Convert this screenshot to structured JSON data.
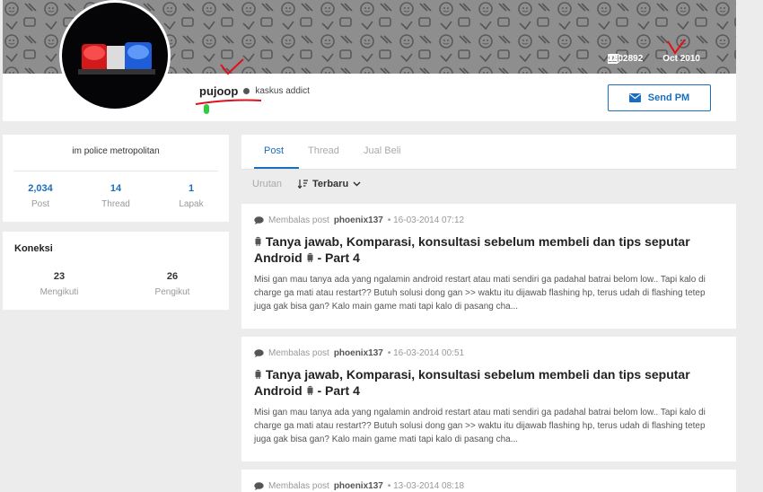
{
  "banner": {
    "id_count": "2202892",
    "join_date": "Oct 2010"
  },
  "profile": {
    "username": "pujoop",
    "rank": "kaskus addict",
    "send_pm": "Send PM",
    "bio": "im police metropolitan"
  },
  "stats": [
    {
      "value": "2,034",
      "label": "Post"
    },
    {
      "value": "14",
      "label": "Thread"
    },
    {
      "value": "1",
      "label": "Lapak"
    }
  ],
  "connections": {
    "title": "Koneksi",
    "items": [
      {
        "value": "23",
        "label": "Mengikuti"
      },
      {
        "value": "26",
        "label": "Pengikut"
      }
    ]
  },
  "tabs": [
    "Post",
    "Thread",
    "Jual Beli"
  ],
  "sort": {
    "label": "Urutan",
    "selected": "Terbaru"
  },
  "posts": [
    {
      "prefix": "Membalas post",
      "author": "phoenix137",
      "time": "• 16-03-2014 07:12",
      "title": "Tanya jawab, Komparasi, konsultasi sebelum membeli dan tips seputar Android",
      "suffix": "- Part 4",
      "excerpt": "Misi gan mau tanya ada yang ngalamin android restart atau mati sendiri ga padahal batrai belom low.. Tapi kalo di charge ga mati atau restart?? Butuh solusi dong gan >> waktu itu dijawab flashing hp, terus udah di flashing tetep juga gak bisa gan? Kalo main game mati tapi kalo di pasang cha..."
    },
    {
      "prefix": "Membalas post",
      "author": "phoenix137",
      "time": "• 16-03-2014 00:51",
      "title": "Tanya jawab, Komparasi, konsultasi sebelum membeli dan tips seputar Android",
      "suffix": "- Part 4",
      "excerpt": "Misi gan mau tanya ada yang ngalamin android restart atau mati sendiri ga padahal batrai belom low.. Tapi kalo di charge ga mati atau restart?? Butuh solusi dong gan >> waktu itu dijawab flashing hp, terus udah di flashing tetep juga gak bisa gan? Kalo main game mati tapi kalo di pasang cha..."
    },
    {
      "prefix": "Membalas post",
      "author": "phoenix137",
      "time": "• 13-03-2014 08:18"
    }
  ],
  "colors": {
    "accent": "#1b6ebd",
    "annotation": "#e0101a",
    "online": "#2ecc40"
  },
  "icons": {
    "id_card": "id-card-icon",
    "calendar": "calendar-check-icon",
    "envelope": "envelope-icon",
    "comment": "comment-icon",
    "sort": "sort-icon",
    "chevron": "chevron-down-icon",
    "android": "android-icon"
  }
}
